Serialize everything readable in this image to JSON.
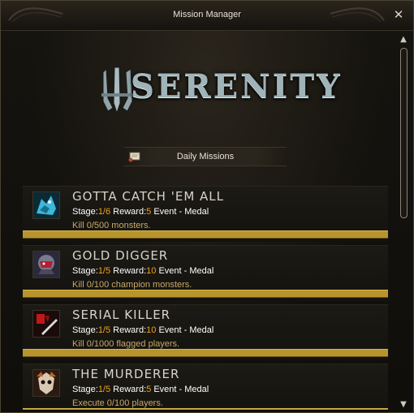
{
  "window": {
    "title": "Mission Manager"
  },
  "logo": {
    "text": "SERENITY"
  },
  "daily_button": {
    "label": "Daily Missions",
    "icon": "scroll-icon"
  },
  "colors": {
    "accent": "#f2a21a",
    "bar": "#b8952c",
    "desc": "#c8aa6a"
  },
  "missions": [
    {
      "name": "GOTTA CATCH 'EM ALL",
      "stage_label": "Stage:",
      "stage": "1/6",
      "reward_label": "Reward:",
      "reward": "5",
      "event": "Event - Medal",
      "desc": "Kill 0/500 monsters.",
      "icon": "blue-beast-icon",
      "progress": 0
    },
    {
      "name": "GOLD DIGGER",
      "stage_label": "Stage:",
      "stage": "1/5",
      "reward_label": "Reward:",
      "reward": "10",
      "event": "Event - Medal",
      "desc": "Kill 0/100 champion monsters.",
      "icon": "masked-rogue-icon",
      "progress": 0
    },
    {
      "name": "SERIAL KILLER",
      "stage_label": "Stage:",
      "stage": "1/5",
      "reward_label": "Reward:",
      "reward": "10",
      "event": "Event - Medal",
      "desc": "Kill 0/1000 flagged players.",
      "icon": "red-blade-icon",
      "progress": 0
    },
    {
      "name": "THE MURDERER",
      "stage_label": "Stage:",
      "stage": "1/5",
      "reward_label": "Reward:",
      "reward": "5",
      "event": "Event - Medal",
      "desc": "Execute 0/100 players.",
      "icon": "skull-mask-icon",
      "progress": 0
    }
  ]
}
